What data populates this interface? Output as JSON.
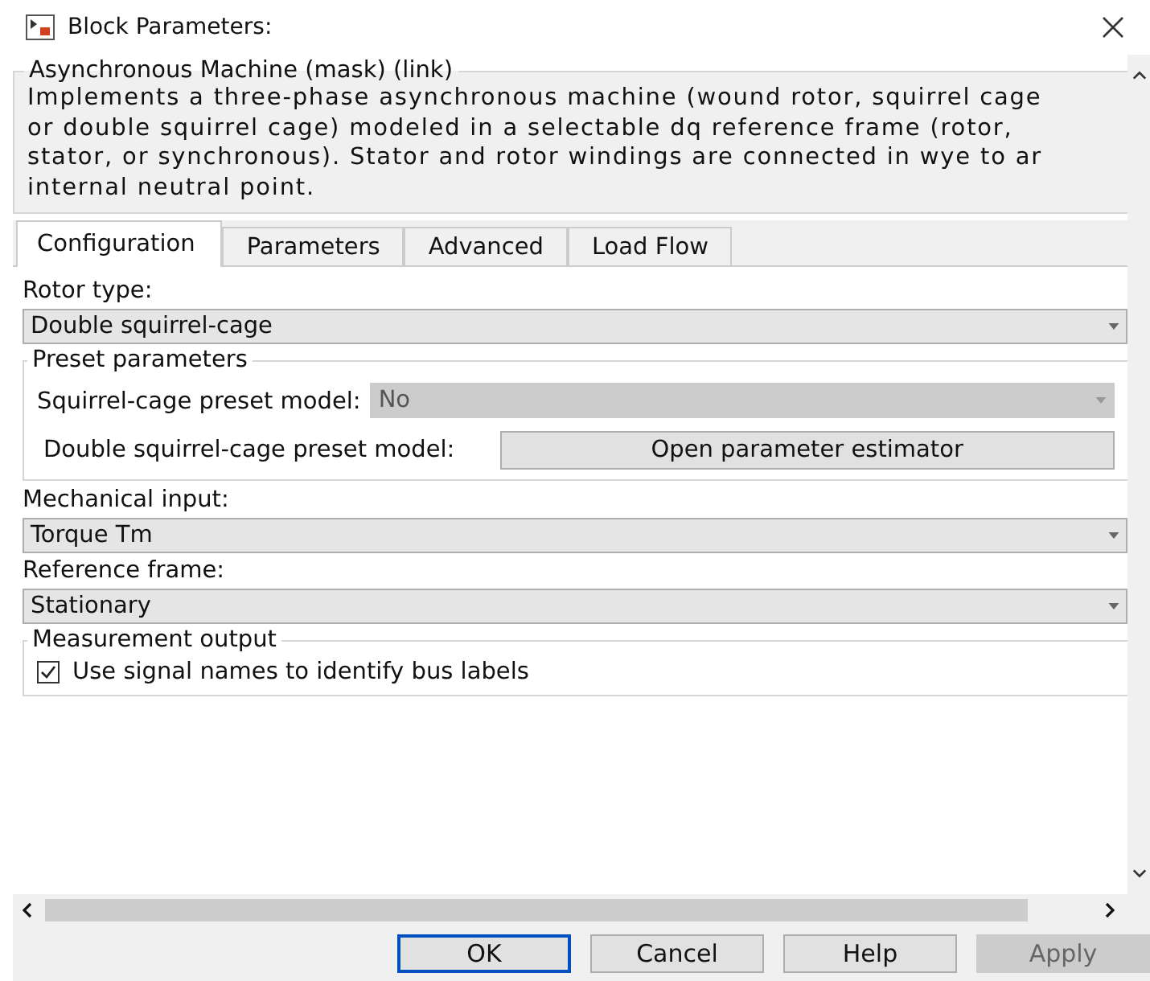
{
  "window": {
    "title": "Block Parameters:"
  },
  "mask": {
    "title": "Asynchronous Machine (mask) (link)",
    "description": "Implements a three-phase asynchronous machine (wound rotor, squirrel cage\nor double squirrel cage) modeled in a selectable dq reference frame (rotor,\nstator, or synchronous). Stator and rotor windings are connected in wye to ar\ninternal neutral point."
  },
  "tabs": [
    {
      "label": "Configuration",
      "selected": true
    },
    {
      "label": "Parameters",
      "selected": false
    },
    {
      "label": "Advanced",
      "selected": false
    },
    {
      "label": "Load Flow",
      "selected": false
    }
  ],
  "rotor_type": {
    "label": "Rotor type:",
    "value": "Double squirrel-cage"
  },
  "preset": {
    "title": "Preset parameters",
    "squirrel_label": "Squirrel-cage preset model:",
    "squirrel_value": "No",
    "squirrel_disabled": true,
    "double_label": "Double squirrel-cage preset model:",
    "double_button": "Open parameter estimator"
  },
  "mechanical_input": {
    "label": "Mechanical input:",
    "value": "Torque Tm"
  },
  "reference_frame": {
    "label": "Reference frame:",
    "value": "Stationary"
  },
  "measurement": {
    "title": "Measurement output",
    "checkbox_label": "Use signal names to identify bus labels",
    "checked": true
  },
  "buttons": [
    {
      "label": "OK",
      "kind": "default",
      "disabled": false
    },
    {
      "label": "Cancel",
      "kind": "normal",
      "disabled": false
    },
    {
      "label": "Help",
      "kind": "normal",
      "disabled": false
    },
    {
      "label": "Apply",
      "kind": "normal",
      "disabled": true
    }
  ]
}
